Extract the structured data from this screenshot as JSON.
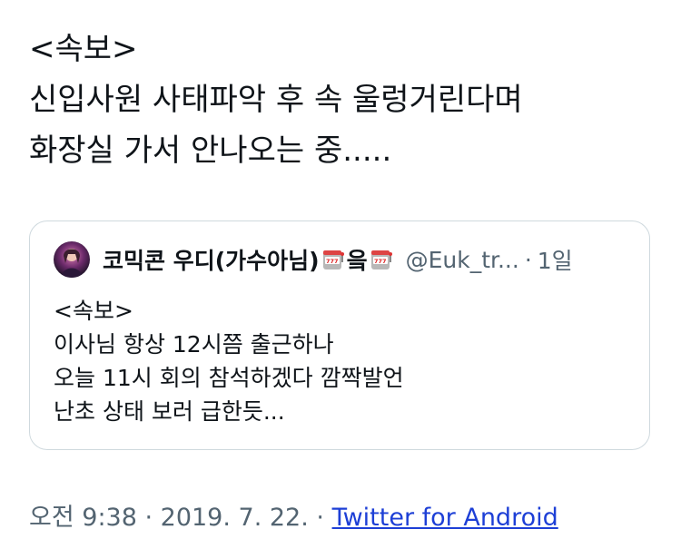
{
  "tweet": {
    "lines": [
      "<속보>",
      "신입사원 사태파악 후 속 울렁거린다며",
      "화장실 가서 안나오는 중....."
    ]
  },
  "quoted_tweet": {
    "display_name": "코믹콘 우디(가수아님)",
    "name_suffix": "읔",
    "handle": "@Euk_tr...",
    "separator": "·",
    "time_ago": "1일",
    "lines": [
      "<속보>",
      "이사님 항상 12시쯤 출근하나",
      "오늘 11시 회의 참석하겠다 깜짝발언",
      "난초 상태 보러 급한듯..."
    ],
    "avatar_icon": "user-avatar",
    "emoji_icon": "slot-machine-icon"
  },
  "meta": {
    "timestamp": "오전 9:38 · 2019. 7. 22. · ",
    "source": "Twitter for Android"
  },
  "colors": {
    "text": "#0f1419",
    "secondary": "#536471",
    "border": "#cfd9de",
    "link": "#1d3fd6"
  }
}
